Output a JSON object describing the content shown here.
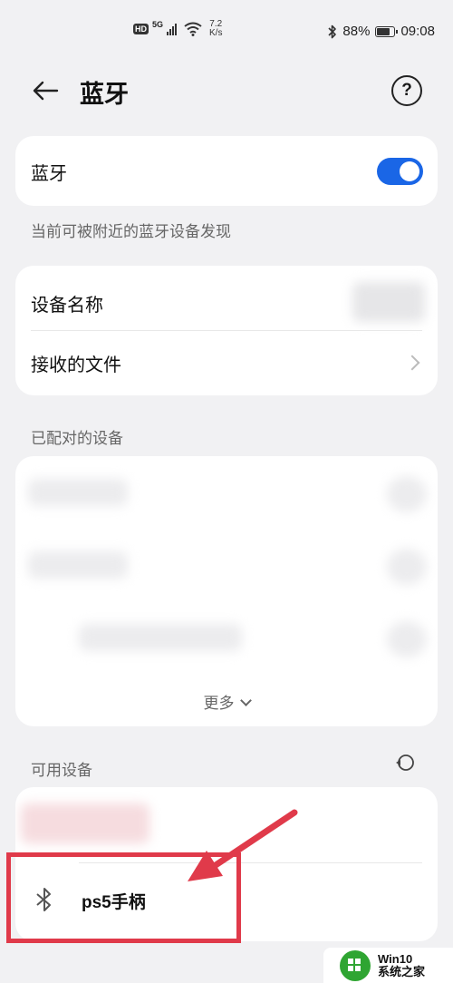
{
  "status_bar": {
    "hd_label": "HD",
    "network_label": "5G",
    "speed_value": "7.2",
    "speed_unit": "K/s",
    "battery_percent": "88%",
    "time": "09:08",
    "battery_level": 0.88
  },
  "header": {
    "title": "蓝牙",
    "help_symbol": "?"
  },
  "bluetooth_card": {
    "label": "蓝牙",
    "enabled": true
  },
  "discoverable_note": "当前可被附近的蓝牙设备发现",
  "settings_card": {
    "device_name_label": "设备名称",
    "received_files_label": "接收的文件"
  },
  "paired_section": {
    "label": "已配对的设备",
    "more_label": "更多"
  },
  "available_section": {
    "label": "可用设备",
    "device": {
      "name": "ps5手柄",
      "icon": "bluetooth-icon"
    }
  },
  "watermark": {
    "line1": "Win10",
    "line2": "系统之家"
  },
  "colors": {
    "accent": "#1a66e6",
    "highlight": "#e03a4a",
    "background": "#f1f1f3"
  }
}
